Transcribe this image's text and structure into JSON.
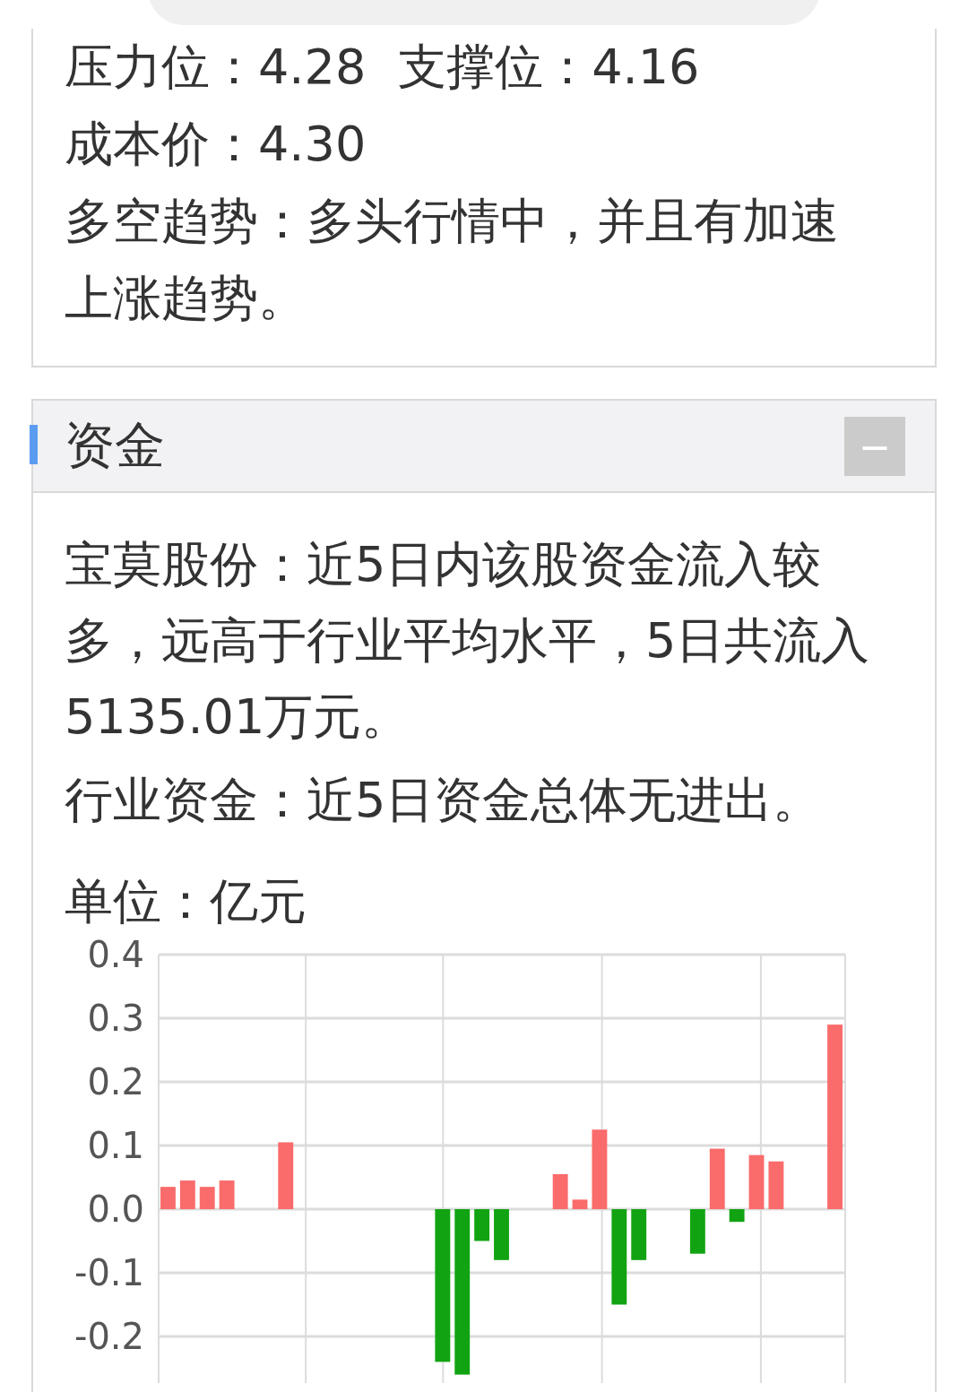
{
  "analysis_card": {
    "lines": [
      {
        "items": [
          "压力位：4.28",
          "支撑位：4.16"
        ]
      },
      {
        "items": [
          "成本价：4.30"
        ]
      },
      {
        "items": [
          "多空趋势：多头行情中，并且有加速上涨趋势。"
        ]
      }
    ]
  },
  "funds_section": {
    "title": "资金",
    "collapse_button": "—",
    "paragraphs": [
      "宝莫股份：近5日内该股资金流入较多，远高于行业平均水平，5日共流入5135.01万元。",
      "行业资金：近5日资金总体无进出。"
    ],
    "unit": "单位：亿元",
    "chart_data": {
      "type": "bar",
      "grid": true,
      "ylim": [
        -0.27,
        0.4
      ],
      "yticks": [
        0.4,
        0.3,
        0.2,
        0.1,
        {
          "value": 0,
          "label": "0.0"
        },
        -0.1,
        -0.2
      ],
      "series": [
        {
          "color": "#fa6b6b",
          "values": [
            0.035,
            0.045,
            0.035,
            0.045,
            null,
            null,
            0.105,
            null,
            null,
            null,
            null,
            null,
            null,
            null,
            null,
            null,
            null,
            null,
            null,
            null,
            0.055,
            0.015,
            0.125,
            null,
            null,
            null,
            null,
            null,
            0.095,
            null,
            0.085,
            0.075,
            null,
            null,
            0.29
          ]
        },
        {
          "color": "#12a312",
          "values": [
            null,
            null,
            null,
            null,
            null,
            null,
            null,
            null,
            null,
            null,
            null,
            null,
            null,
            null,
            -0.24,
            -0.26,
            -0.05,
            -0.08,
            null,
            null,
            null,
            null,
            null,
            -0.15,
            -0.08,
            null,
            null,
            -0.07,
            null,
            -0.02,
            null,
            null,
            null,
            null,
            null
          ]
        }
      ]
    }
  }
}
